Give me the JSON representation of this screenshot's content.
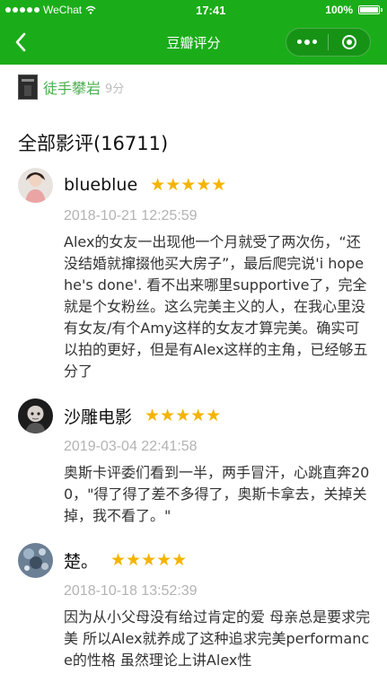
{
  "status_bar": {
    "carrier": "WeChat",
    "time": "17:41",
    "battery": "100%"
  },
  "nav": {
    "title": "豆瓣评分"
  },
  "movie": {
    "title": "徒手攀岩",
    "rating": "9分"
  },
  "section": {
    "title": "全部影评(16711)"
  },
  "reviews": [
    {
      "user": "blueblue",
      "stars": "★★★★★",
      "date": "2018-10-21 12:25:59",
      "content": "Alex的女友一出现他一个月就受了两次伤，“还没结婚就撺掇他买大房子”，最后爬完说'i hope he's done'. 看不出来哪里supportive了，完全就是个女粉丝。这么完美主义的人，在我心里没有女友/有个Amy这样的女友才算完美。确实可以拍的更好，但是有Alex这样的主角，已经够五分了"
    },
    {
      "user": "沙雕电影",
      "stars": "★★★★★",
      "date": "2019-03-04 22:41:58",
      "content": "奥斯卡评委们看到一半，两手冒汗，心跳直奔200，\"得了得了差不多得了，奥斯卡拿去，关掉关掉，我不看了。\""
    },
    {
      "user": "楚。",
      "stars": "★★★★★",
      "date": "2018-10-18 13:52:39",
      "content": "因为从小父母没有给过肯定的爱 母亲总是要求完美 所以Alex就养成了这种追求完美performance的性格 虽然理论上讲Alex性"
    }
  ],
  "colors": {
    "brand_green": "#1aad19",
    "movie_title_green": "#4caf50",
    "star_gold": "#f4b400",
    "date_gray": "#b3b3b3"
  },
  "icons": {
    "back": "chevron-left-icon",
    "more": "more-dots-icon",
    "close": "target-circle-icon"
  }
}
